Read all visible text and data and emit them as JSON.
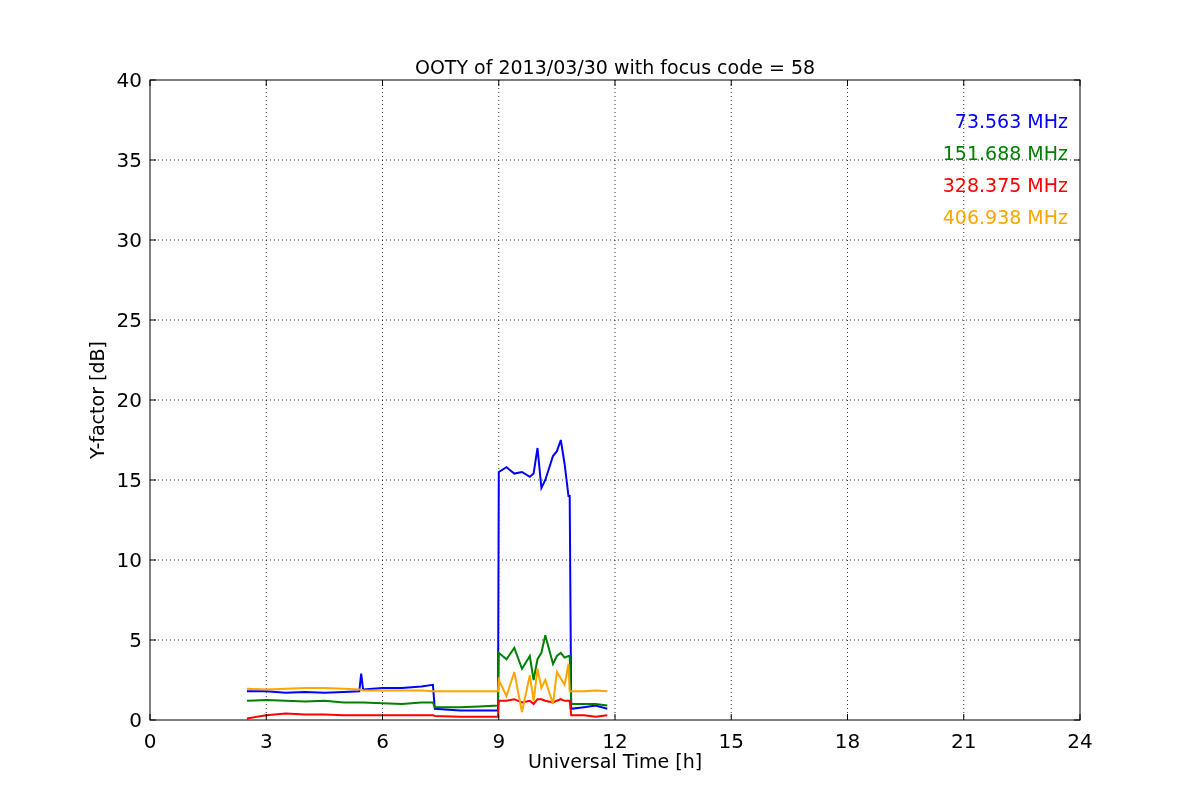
{
  "chart_data": {
    "type": "line",
    "title": "OOTY of 2013/03/30 with focus code = 58",
    "xlabel": "Universal Time [h]",
    "ylabel": "Y-factor [dB]",
    "x": [
      2.5,
      3,
      3.5,
      4,
      4.5,
      5,
      5.4,
      5.45,
      5.5,
      6,
      6.5,
      7,
      7.3,
      7.35,
      8,
      8.5,
      8.98,
      9.0,
      9.2,
      9.4,
      9.6,
      9.8,
      9.9,
      10.0,
      10.1,
      10.2,
      10.4,
      10.5,
      10.6,
      10.7,
      10.8,
      10.83,
      10.87,
      11.2,
      11.5,
      11.8
    ],
    "series": [
      {
        "name": "73.563 MHz",
        "color": "#0000ff",
        "values": [
          1.8,
          1.8,
          1.7,
          1.75,
          1.7,
          1.75,
          1.8,
          2.9,
          1.9,
          2.0,
          2.0,
          2.1,
          2.2,
          0.7,
          0.6,
          0.6,
          0.6,
          15.5,
          15.8,
          15.4,
          15.5,
          15.2,
          15.4,
          17.0,
          14.5,
          15.0,
          16.5,
          16.8,
          17.5,
          16.0,
          14.0,
          14.0,
          0.7,
          0.8,
          0.9,
          0.7
        ]
      },
      {
        "name": "151.688 MHz",
        "color": "#008000",
        "values": [
          1.2,
          1.25,
          1.2,
          1.15,
          1.2,
          1.1,
          1.1,
          1.1,
          1.1,
          1.05,
          1.0,
          1.1,
          1.1,
          0.8,
          0.8,
          0.85,
          0.9,
          4.2,
          3.8,
          4.5,
          3.2,
          4.0,
          2.5,
          3.8,
          4.2,
          5.3,
          3.5,
          4.0,
          4.2,
          3.9,
          4.0,
          4.0,
          1.0,
          1.0,
          1.0,
          0.9
        ]
      },
      {
        "name": "328.375 MHz",
        "color": "#ff0000",
        "values": [
          0.1,
          0.3,
          0.4,
          0.35,
          0.35,
          0.3,
          0.3,
          0.3,
          0.3,
          0.3,
          0.3,
          0.3,
          0.3,
          0.25,
          0.2,
          0.2,
          0.2,
          1.2,
          1.2,
          1.3,
          1.1,
          1.2,
          1.0,
          1.3,
          1.3,
          1.2,
          1.1,
          1.2,
          1.3,
          1.2,
          1.2,
          1.2,
          0.3,
          0.3,
          0.2,
          0.3
        ]
      },
      {
        "name": "406.938 MHz",
        "color": "#ffa500",
        "values": [
          1.95,
          1.9,
          1.95,
          2.0,
          2.0,
          1.95,
          1.9,
          1.9,
          1.85,
          1.85,
          1.85,
          1.85,
          1.8,
          1.8,
          1.8,
          1.8,
          1.8,
          2.5,
          1.5,
          3.0,
          0.5,
          2.8,
          1.2,
          3.2,
          2.0,
          2.5,
          1.0,
          3.0,
          2.6,
          2.2,
          3.5,
          1.8,
          1.8,
          1.8,
          1.85,
          1.8
        ]
      }
    ],
    "xlim": [
      0,
      24
    ],
    "ylim": [
      0,
      40
    ],
    "xticks": [
      0,
      3,
      6,
      9,
      12,
      15,
      18,
      21,
      24
    ],
    "yticks": [
      0,
      5,
      10,
      15,
      20,
      25,
      30,
      35,
      40
    ],
    "grid": true
  }
}
